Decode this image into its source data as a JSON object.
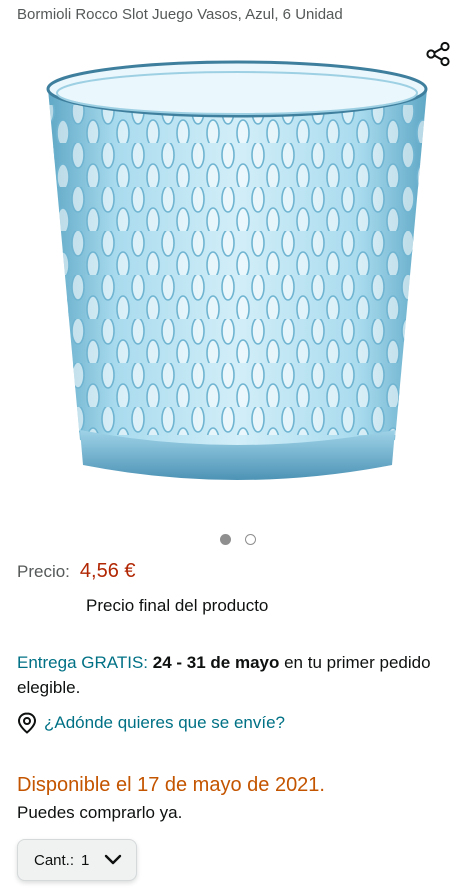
{
  "product": {
    "title": "Bormioli Rocco Slot Juego Vasos, Azul, 6 Unidad",
    "image_alt": "vaso de vidrio azul",
    "accent_color": "#9fd3e8"
  },
  "icons": {
    "share": "share-icon",
    "location": "location-pin-icon",
    "dropdown": "chevron-down-icon"
  },
  "carousel": {
    "total": 2,
    "active": 1
  },
  "price": {
    "label": "Precio:",
    "value": "4,56 €",
    "note": "Precio final del producto"
  },
  "delivery": {
    "prefix": "Entrega GRATIS:",
    "dates": "24 - 31 de mayo",
    "suffix": " en tu primer pedido elegible."
  },
  "location": {
    "link": "¿Adónde quieres que se envíe?"
  },
  "availability": {
    "status": "Disponible el 17 de mayo de 2021.",
    "subtext": "Puedes comprarlo ya."
  },
  "quantity": {
    "label": "Cant.:",
    "value": "1"
  },
  "colors": {
    "price": "#b12704",
    "link": "#007185",
    "availability": "#c45500"
  }
}
